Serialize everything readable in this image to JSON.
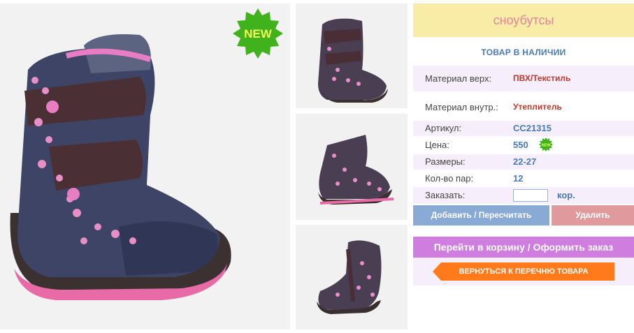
{
  "product": {
    "title": "сноубутсы",
    "stock_status": "ТОВАР В НАЛИЧИИ",
    "new_badge": "NEW",
    "mini_new_badge": "NEW"
  },
  "specs": [
    {
      "label": "Материал верх:",
      "value": "ПВХ/Текстиль"
    },
    {
      "label": "Материал внутр.:",
      "value": "Утеплитель"
    },
    {
      "label": "Артикул:",
      "value": "CC21315"
    },
    {
      "label": "Цена:",
      "value": "550"
    },
    {
      "label": "Размеры:",
      "value": "22-27"
    },
    {
      "label": "Кол-во пар:",
      "value": "12"
    }
  ],
  "order": {
    "label": "Заказать:",
    "input_value": "",
    "unit": "кор."
  },
  "buttons": {
    "add_recalc": "Добавить / Пересчитать",
    "delete": "Удалить",
    "go_to_cart": "Перейти в корзину / Оформить заказ",
    "back_to_list": "ВЕРНУТЬСЯ К ПЕРЕЧНЮ ТОВАРА"
  },
  "colors": {
    "title_bg": "#f8eca6",
    "title_text": "#e3869a",
    "accent_blue": "#4a7ab8",
    "add_button": "#8aaad6",
    "delete_button": "#e09a9e",
    "cart_button": "#cf7ee0",
    "back_button": "#ff7a1a",
    "badge_green": "#3fb21c"
  },
  "icons": [
    "new-badge-icon",
    "mini-new-badge-icon",
    "back-arrow-icon"
  ]
}
